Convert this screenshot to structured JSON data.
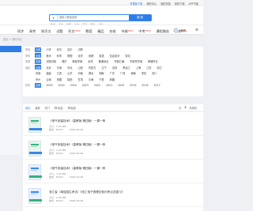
{
  "topbar": {
    "links": [
      "苹果版下载",
      "我的中心",
      "我的充值",
      "我的下载",
      "APP下载"
    ],
    "highlight_index": 0
  },
  "search": {
    "category": "▾",
    "placeholder": "搜索人教版选修",
    "button": "搜 索"
  },
  "hot_keywords": [
    "数学",
    "语文",
    "物理",
    "化学",
    "英语",
    "课件",
    "试卷"
  ],
  "nav": {
    "items": [
      "同步",
      "高考",
      "知识点",
      "试题",
      "作文",
      "教案",
      "精品",
      "名校",
      "书城",
      "中考",
      "课程服务",
      "题库"
    ],
    "badges": {
      "4": "NEW",
      "8": "NEW",
      "9": "NEW",
      "11": "NEW"
    },
    "user": "我的"
  },
  "breadcrumb": "首页 > 课时作业",
  "filters": [
    {
      "label": "学段",
      "options": [
        "全部",
        "小学",
        "初中",
        "高中",
        "中职"
      ],
      "active": 0
    },
    {
      "label": "学科",
      "options": [
        "全部",
        "美术",
        "科学",
        "物理",
        "化学",
        "地理",
        "英语",
        "信息技术",
        "劳动"
      ],
      "active": 0
    },
    {
      "label": "类型",
      "options": [
        "全部",
        "试题试卷",
        "课件",
        "教案学案",
        "素材",
        "备课综合",
        "专题汇编",
        "学案导学案",
        "教辅作业"
      ],
      "active": 0
    },
    {
      "label": "地区",
      "options": [
        "全部",
        "北京",
        "天津",
        "河北",
        "山西",
        "内蒙古",
        "辽宁",
        "吉林",
        "黑龙江",
        "上海",
        "江苏",
        "浙江"
      ],
      "active": 0
    },
    {
      "label": "",
      "options": [
        "安徽",
        "福建",
        "江西",
        "山东",
        "河南",
        "湖北",
        "湖南",
        "广东",
        "广西",
        "海南",
        "重庆",
        "四川"
      ],
      "active": -1
    },
    {
      "label": "",
      "options": [
        "贵州",
        "云南",
        "西藏",
        "陕西",
        "甘肃",
        "青海",
        "宁夏",
        "新疆"
      ],
      "active": -1
    },
    {
      "label": "年份",
      "options": [
        "全部",
        "2026",
        "2025",
        "2024",
        "2023",
        "2022",
        "2021",
        "2020",
        "2019",
        "2018",
        "2017"
      ],
      "active": 0
    }
  ],
  "sortbar": {
    "tabs": [
      "综合",
      "最新",
      "热门"
    ],
    "active": 0,
    "checkboxes": [
      "精品",
      "免费"
    ],
    "count_prefix": "共",
    "count": "1",
    "count_suffix": "份资料"
  },
  "results": [
    {
      "title": "《电气测量技术》（高教版·第四版）一课一练",
      "meta": "大小：1.57 MB",
      "format": "格式：DOCX",
      "date": "2024-09-06",
      "thumb": "green"
    },
    {
      "title": "《电气测量技术》（高教版·第四版）一课一练",
      "meta": "大小：1.93 MB",
      "format": "格式：DOCX",
      "date": "2024-09-06",
      "thumb": "green"
    },
    {
      "title": "《电气测量技术》（高教版·第四版）一课一练",
      "meta": "大小：1.02 MB",
      "format": "格式：DOCX",
      "date": "2024-09-06",
      "thumb": "blue"
    },
    {
      "title": "浙江省（单独招生考试）《电工电子类理论知识考点总复习》",
      "meta": "大小：2.36 MB",
      "format": "格式：DOCX",
      "date": "2024-09-06",
      "thumb": "blue"
    }
  ]
}
